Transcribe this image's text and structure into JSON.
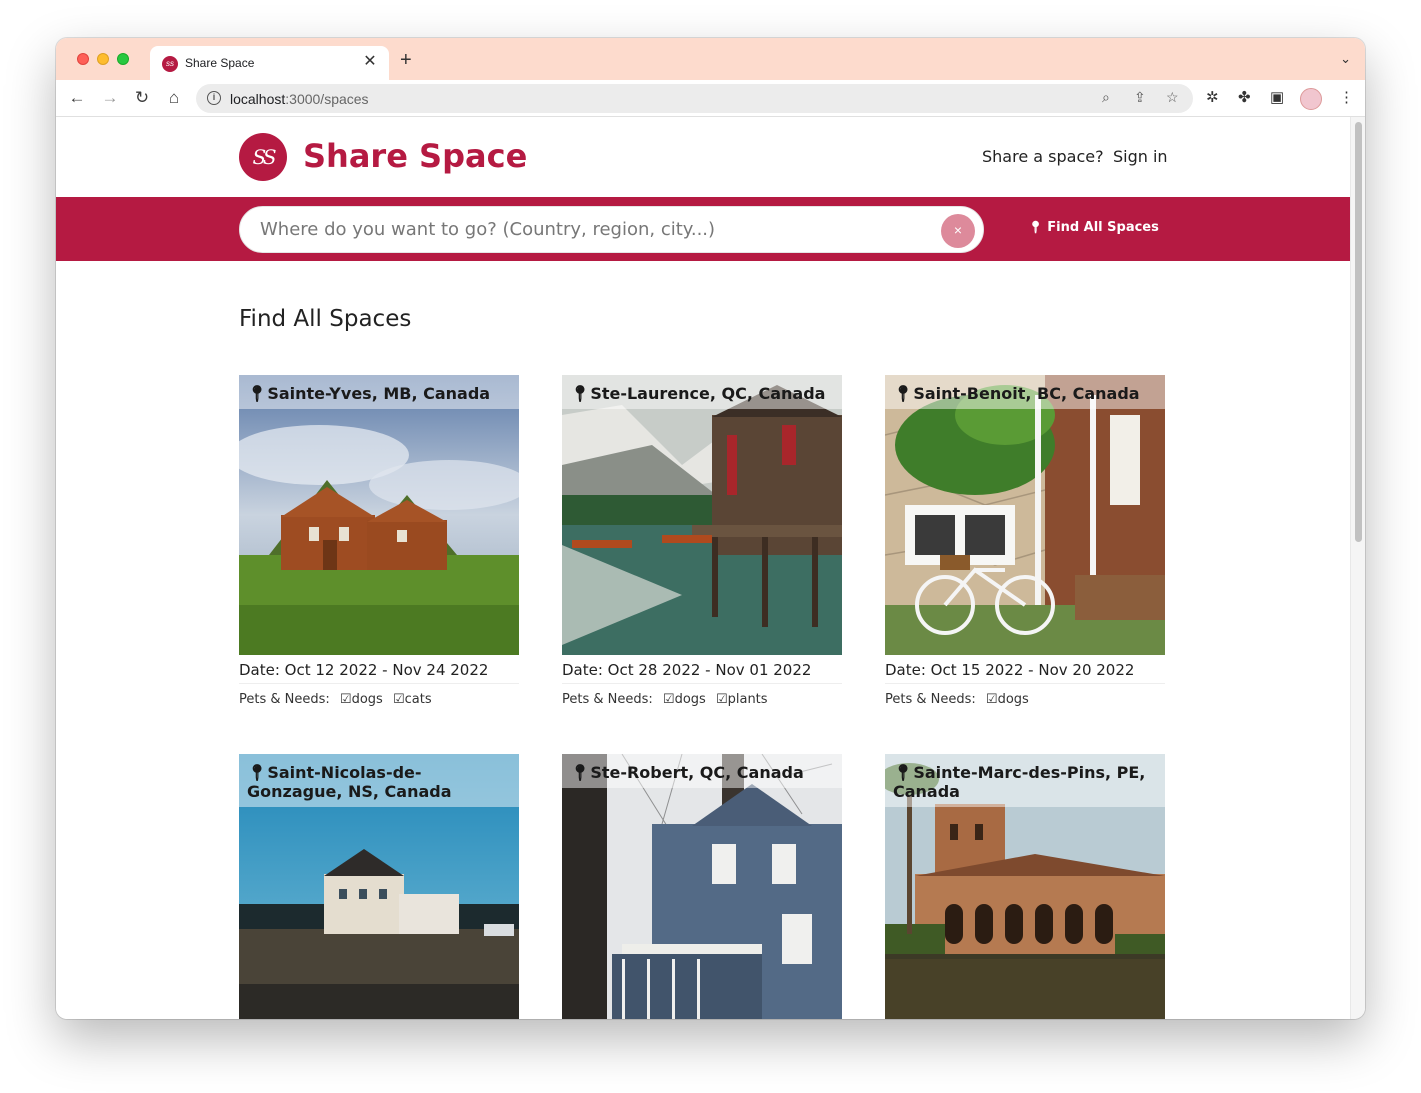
{
  "browser": {
    "tab_title": "Share Space",
    "url_host": "localhost",
    "url_path": ":3000/spaces"
  },
  "site": {
    "brand_initials": "SS",
    "brand_name": "Share Space",
    "nav": {
      "share_label": "Share a space?",
      "signin_label": "Sign in"
    },
    "search": {
      "placeholder": "Where do you want to go? (Country, region, city...)",
      "clear_label": "×",
      "find_all_label": "Find All Spaces"
    },
    "page_title": "Find All Spaces",
    "pets_label": "Pets & Needs:",
    "cards": [
      {
        "location": "Sainte-Yves, MB, Canada",
        "date": "Date: Oct 12 2022 - Nov 24 2022",
        "tags": [
          "dogs",
          "cats"
        ]
      },
      {
        "location": "Ste-Laurence, QC, Canada",
        "date": "Date: Oct 28 2022 - Nov 01 2022",
        "tags": [
          "dogs",
          "plants"
        ]
      },
      {
        "location": "Saint-Benoit, BC, Canada",
        "date": "Date: Oct 15 2022 - Nov 20 2022",
        "tags": [
          "dogs"
        ]
      },
      {
        "location": "Saint-Nicolas-de-Gonzague, NS, Canada",
        "date": "",
        "tags": []
      },
      {
        "location": "Ste-Robert, QC, Canada",
        "date": "",
        "tags": []
      },
      {
        "location": "Sainte-Marc-des-Pins, PE, Canada",
        "date": "",
        "tags": []
      }
    ]
  },
  "colors": {
    "brand": "#b51a42",
    "tab_strip": "#fddbcd",
    "clear_button": "#dd8a9b"
  }
}
